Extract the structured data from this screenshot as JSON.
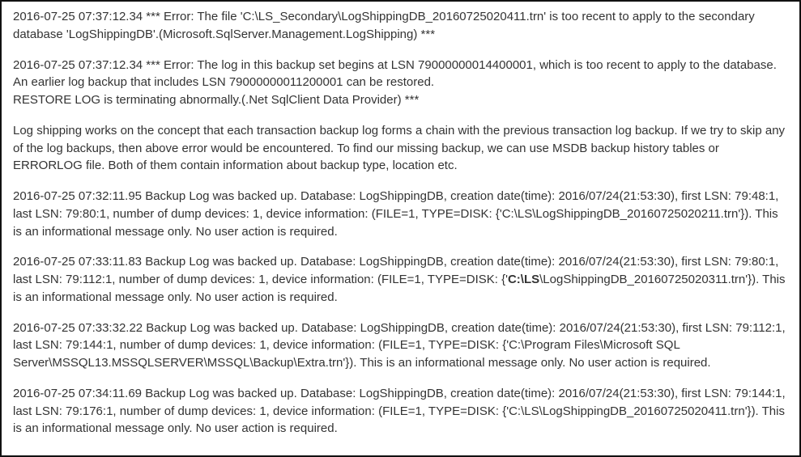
{
  "entries": [
    {
      "text": "2016-07-25 07:37:12.34  *** Error: The file 'C:\\LS_Secondary\\LogShippingDB_20160725020411.trn' is too recent to apply to the secondary database 'LogShippingDB'.(Microsoft.SqlServer.Management.LogShipping) ***"
    },
    {
      "text": "2016-07-25 07:37:12.34  *** Error: The log in this backup set begins at LSN 79000000014400001, which is too recent to apply to the database. An earlier log backup that includes LSN 79000000011200001 can be restored.\nRESTORE LOG is terminating abnormally.(.Net SqlClient Data Provider) ***"
    },
    {
      "text": "Log shipping works on the concept that each transaction backup log forms a chain with the previous transaction log backup. If we try to skip any of the log backups, then above error would be encountered. To find our missing backup, we can use MSDB backup history tables or ERRORLOG file. Both of them contain information about backup type, location etc."
    },
    {
      "text": "2016-07-25 07:32:11.95 Backup     Log was backed up. Database: LogShippingDB, creation date(time): 2016/07/24(21:53:30), first LSN: 79:48:1, last LSN: 79:80:1, number of dump devices: 1, device information: (FILE=1, TYPE=DISK: {'C:\\LS\\LogShippingDB_20160725020211.trn'}). This is an informational message only. No user action is required."
    },
    {
      "prefix": "2016-07-25 07:33:11.83 Backup     Log was backed up. Database: LogShippingDB, creation date(time): 2016/07/24(21:53:30), first LSN: 79:80:1, last LSN: 79:112:1, number of dump devices: 1, device information: (FILE=1, TYPE=DISK: {'",
      "bold": "C:\\LS",
      "suffix": "\\LogShippingDB_20160725020311.trn'}). This is an informational message only. No user action is required."
    },
    {
      "text": "2016-07-25 07:33:32.22 Backup     Log was backed up. Database: LogShippingDB, creation date(time): 2016/07/24(21:53:30), first LSN: 79:112:1, last LSN: 79:144:1, number of dump devices: 1, device information: (FILE=1, TYPE=DISK: {'C:\\Program Files\\Microsoft SQL Server\\MSSQL13.MSSQLSERVER\\MSSQL\\Backup\\Extra.trn'}). This is an informational message only. No user action is required."
    },
    {
      "text": "2016-07-25 07:34:11.69 Backup     Log was backed up. Database: LogShippingDB, creation date(time): 2016/07/24(21:53:30), first LSN: 79:144:1, last LSN: 79:176:1, number of dump devices: 1, device information: (FILE=1, TYPE=DISK: {'C:\\LS\\LogShippingDB_20160725020411.trn'}). This is an informational message only. No user action is required."
    }
  ]
}
